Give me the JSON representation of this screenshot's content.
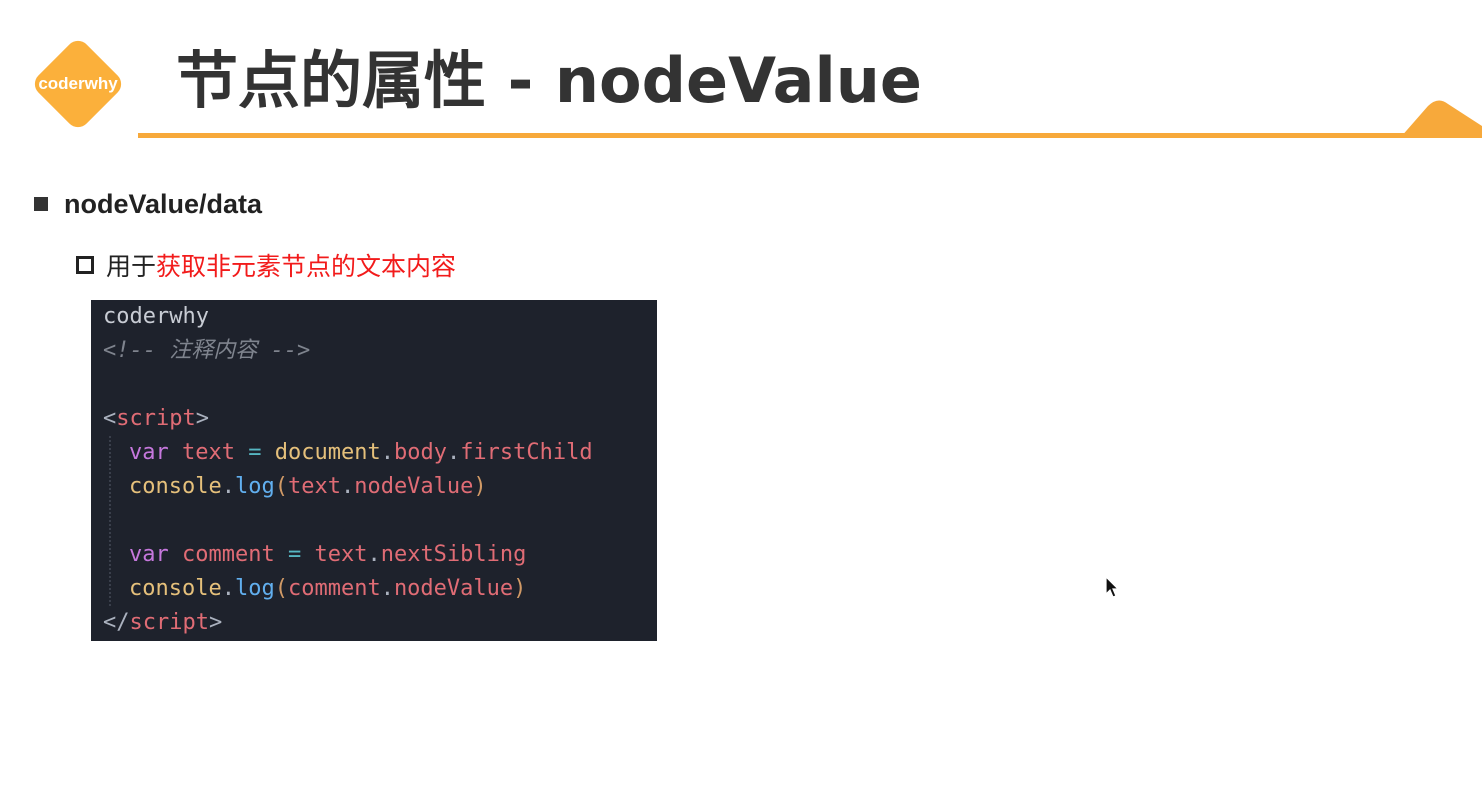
{
  "logo": {
    "text": "coderwhy",
    "color": "#fbb03b"
  },
  "title": "节点的属性 - nodeValue",
  "accent_color": "#f7a93b",
  "bullets": {
    "level1": "nodeValue/data",
    "level2_plain": "用于",
    "level2_highlight": "获取非元素节点的文本内容"
  },
  "code": {
    "line1": "coderwhy",
    "line2": "<!-- 注释内容 -->",
    "script_open_lt": "<",
    "script_tag": "script",
    "script_open_gt": ">",
    "var1_keyword": "var",
    "var1_name": "text",
    "var1_eq": "=",
    "var1_obj": "document",
    "var1_prop1": "body",
    "var1_prop2": "firstChild",
    "log1_obj": "console",
    "log1_fn": "log",
    "log1_arg_obj": "text",
    "log1_arg_prop": "nodeValue",
    "var2_keyword": "var",
    "var2_name": "comment",
    "var2_eq": "=",
    "var2_obj": "text",
    "var2_prop": "nextSibling",
    "log2_obj": "console",
    "log2_fn": "log",
    "log2_arg_obj": "comment",
    "log2_arg_prop": "nodeValue",
    "script_close_lt": "</",
    "script_close_tag": "script",
    "script_close_gt": ">",
    "dot": ".",
    "lparen": "(",
    "rparen": ")",
    "space": " "
  }
}
